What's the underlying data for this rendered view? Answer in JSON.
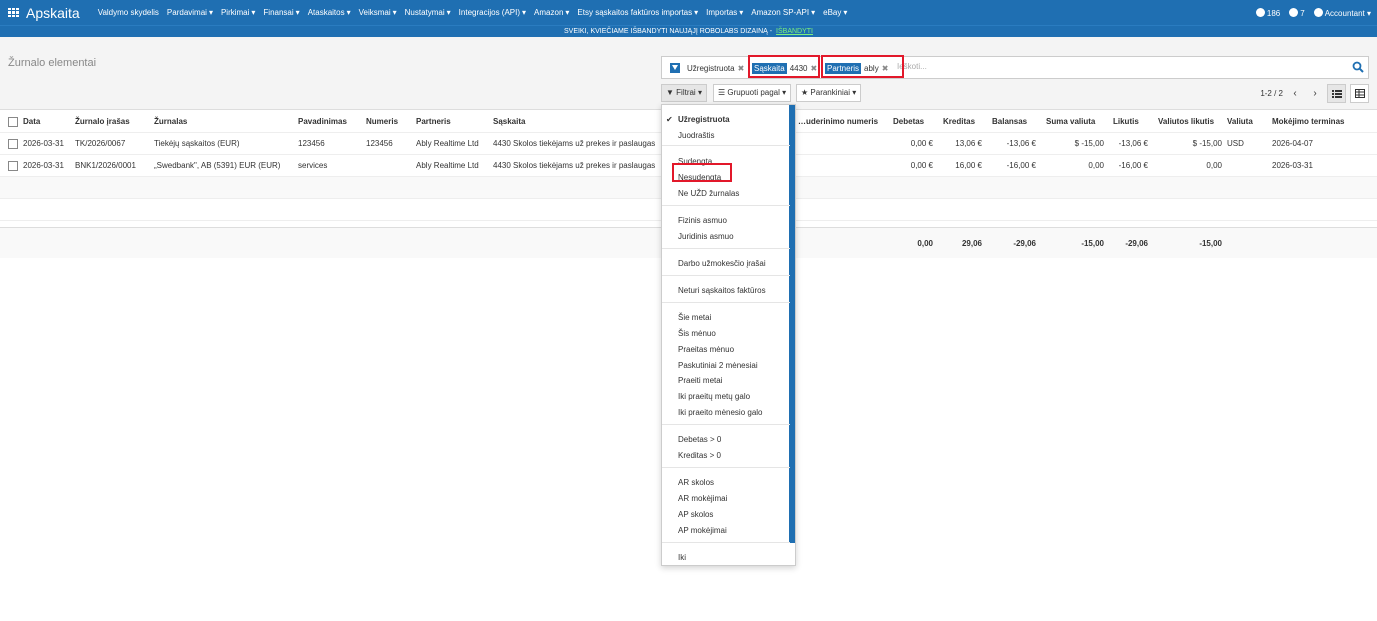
{
  "navbar": {
    "brand": "Apskaita",
    "menu": [
      {
        "label": "Valdymo skydelis",
        "caret": false
      },
      {
        "label": "Pardavimai",
        "caret": true
      },
      {
        "label": "Pirkimai",
        "caret": true
      },
      {
        "label": "Finansai",
        "caret": true
      },
      {
        "label": "Ataskaitos",
        "caret": true
      },
      {
        "label": "Veiksmai",
        "caret": true
      },
      {
        "label": "Nustatymai",
        "caret": true
      },
      {
        "label": "Integracijos (API)",
        "caret": true
      },
      {
        "label": "Amazon",
        "caret": true
      },
      {
        "label": "Etsy sąskaitos faktūros importas",
        "caret": true
      },
      {
        "label": "Importas",
        "caret": true
      },
      {
        "label": "Amazon SP-API",
        "caret": true
      },
      {
        "label": "eBay",
        "caret": true
      }
    ],
    "activity_count": "186",
    "messages_count": "7",
    "user": "Accountant"
  },
  "promo": {
    "text": "SVEIKI, KVIEČIAME IŠBANDYTI NAUJĄJĮ ROBOLABS DIZAINĄ -",
    "link": "IŠBANDYTI"
  },
  "control": {
    "title": "Žurnalo elementai",
    "facets": [
      {
        "tag": "",
        "value": "Užregistruota"
      },
      {
        "tag": "Sąskaita",
        "value": "4430"
      },
      {
        "tag": "Partneris",
        "value": "ably"
      }
    ],
    "search_placeholder": "Ieškoti...",
    "filters_label": "Filtrai",
    "group_label": "Grupuoti pagal",
    "favorites_label": "Parankiniai",
    "pager": "1-2 / 2",
    "colors": {
      "primary": "#1f6fb2",
      "highlight": "#e2182a"
    }
  },
  "table": {
    "headers": [
      "Data",
      "Žurnalo įrašas",
      "Žurnalas",
      "Pavadinimas",
      "Numeris",
      "Partneris",
      "Sąskaita",
      "…uderinimo numeris",
      "Debetas",
      "Kreditas",
      "Balansas",
      "Suma valiuta",
      "Likutis",
      "Valiutos likutis",
      "Valiuta",
      "Mokėjimo terminas"
    ],
    "rows": [
      [
        "2026-03-31",
        "TK/2026/0067",
        "Tiekėjų sąskaitos (EUR)",
        "123456",
        "123456",
        "Ably Realtime Ltd",
        "4430 Skolos tiekėjams už prekes ir paslaugas",
        "",
        "0,00 €",
        "13,06 €",
        "-13,06 €",
        "$ -15,00",
        "-13,06 €",
        "$ -15,00",
        "USD",
        "2026-04-07"
      ],
      [
        "2026-03-31",
        "BNK1/2026/0001",
        "„Swedbank\", AB (5391) EUR (EUR)",
        "services",
        "",
        "Ably Realtime Ltd",
        "4430 Skolos tiekėjams už prekes ir paslaugas",
        "",
        "0,00 €",
        "16,00 €",
        "-16,00 €",
        "0,00",
        "-16,00 €",
        "0,00",
        "",
        "2026-03-31"
      ]
    ],
    "totals": {
      "debit": "0,00",
      "credit": "29,06",
      "balance": "-29,06",
      "amount_currency": "-15,00",
      "residual": "-29,06",
      "residual_currency": "-15,00"
    }
  },
  "filters_menu": [
    {
      "label": "Užregistruota",
      "selected": true
    },
    {
      "label": "Juodraštis"
    },
    {
      "label": "Sudengta"
    },
    {
      "label": "Nesudengta"
    },
    {
      "label": "Ne UŽD žurnalas"
    },
    {
      "label": "Fizinis asmuo"
    },
    {
      "label": "Juridinis asmuo"
    },
    {
      "label": "Darbo užmokesčio įrašai"
    },
    {
      "label": "Neturi sąskaitos faktūros"
    },
    {
      "label": "Šie metai"
    },
    {
      "label": "Šis mėnuo"
    },
    {
      "label": "Praeitas mėnuo"
    },
    {
      "label": "Paskutiniai 2 mėnesiai"
    },
    {
      "label": "Praeiti metai"
    },
    {
      "label": "Iki praeitų metų galo"
    },
    {
      "label": "Iki praeito mėnesio galo"
    },
    {
      "label": "Debetas > 0"
    },
    {
      "label": "Kreditas > 0"
    },
    {
      "label": "AR skolos"
    },
    {
      "label": "AR mokėjimai"
    },
    {
      "label": "AP skolos"
    },
    {
      "label": "AP mokėjimai"
    },
    {
      "label": "Iki"
    }
  ]
}
